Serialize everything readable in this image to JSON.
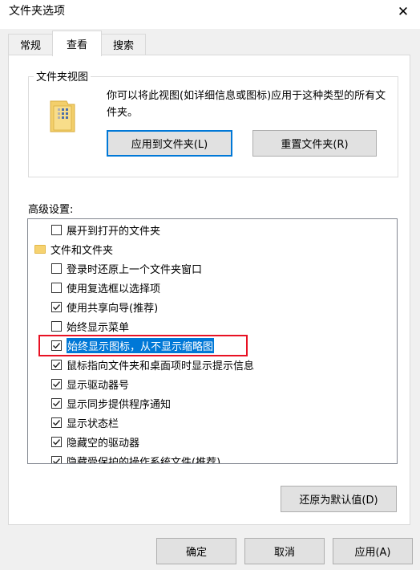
{
  "window": {
    "title": "文件夹选项",
    "close_glyph": "✕"
  },
  "tabs": [
    {
      "label": "常规",
      "active": false
    },
    {
      "label": "查看",
      "active": true
    },
    {
      "label": "搜索",
      "active": false
    }
  ],
  "folder_views": {
    "legend": "文件夹视图",
    "icon": "folder-grid-icon",
    "description": "你可以将此视图(如详细信息或图标)应用于这种类型的所有文件夹。",
    "apply_button": "应用到文件夹(L)",
    "reset_button": "重置文件夹(R)"
  },
  "advanced": {
    "label": "高级设置:",
    "items": [
      {
        "type": "checkbox",
        "label": "展开到打开的文件夹",
        "checked": false
      },
      {
        "type": "folder",
        "label": "文件和文件夹",
        "icon": "folder-icon"
      },
      {
        "type": "checkbox",
        "label": "登录时还原上一个文件夹窗口",
        "checked": false
      },
      {
        "type": "checkbox",
        "label": "使用复选框以选择项",
        "checked": false
      },
      {
        "type": "checkbox",
        "label": "使用共享向导(推荐)",
        "checked": true
      },
      {
        "type": "checkbox",
        "label": "始终显示菜单",
        "checked": false
      },
      {
        "type": "checkbox",
        "label": "始终显示图标，从不显示缩略图",
        "checked": true,
        "selected": true
      },
      {
        "type": "checkbox",
        "label": "鼠标指向文件夹和桌面项时显示提示信息",
        "checked": true
      },
      {
        "type": "checkbox",
        "label": "显示驱动器号",
        "checked": true
      },
      {
        "type": "checkbox",
        "label": "显示同步提供程序通知",
        "checked": true
      },
      {
        "type": "checkbox",
        "label": "显示状态栏",
        "checked": true
      },
      {
        "type": "checkbox",
        "label": "隐藏空的驱动器",
        "checked": true
      },
      {
        "type": "checkbox",
        "label": "隐藏受保护的操作系统文件(推荐)",
        "checked": true
      }
    ],
    "restore_button": "还原为默认值(D)",
    "highlight_color": "#e81123",
    "selection_color": "#0078d7"
  },
  "footer": {
    "ok": "确定",
    "cancel": "取消",
    "apply": "应用(A)"
  }
}
